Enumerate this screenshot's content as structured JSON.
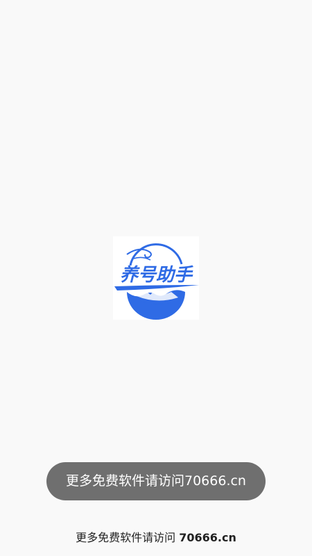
{
  "splash": {
    "logo_text": "养号助手",
    "brand_color": "#2f6be5"
  },
  "toast": {
    "message": "更多免费软件请访问70666.cn"
  },
  "footer": {
    "prefix": "更多免费软件请访问",
    "domain": "70666.cn"
  }
}
